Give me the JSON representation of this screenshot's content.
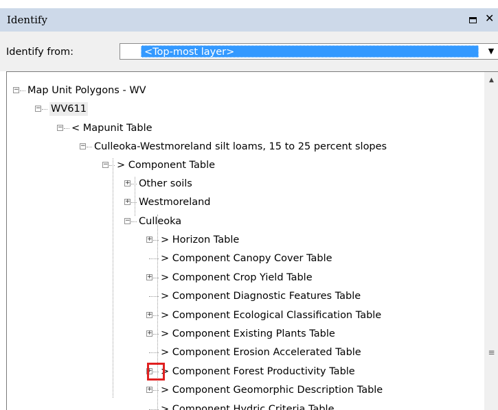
{
  "window": {
    "title": "Identify",
    "maximize_icon": "maximize-icon",
    "close_icon": "close-icon",
    "close_glyph": "✕"
  },
  "identify_from": {
    "label": "Identify from:",
    "value": "<Top-most layer>"
  },
  "tree": {
    "nodes": [
      {
        "label": "Map Unit Polygons - WV",
        "expander": "minus"
      },
      {
        "label": "WV611",
        "expander": "minus"
      },
      {
        "label": "< Mapunit Table",
        "expander": "minus"
      },
      {
        "label": "Culleoka-Westmoreland silt loams, 15 to 25 percent slopes",
        "expander": "minus"
      },
      {
        "label": "> Component Table",
        "expander": "minus"
      },
      {
        "label": "Other soils",
        "expander": "plus"
      },
      {
        "label": "Westmoreland",
        "expander": "plus"
      },
      {
        "label": "Culleoka",
        "expander": "minus"
      },
      {
        "label": "> Horizon Table",
        "expander": "plus"
      },
      {
        "label": "> Component Canopy Cover Table",
        "expander": "none"
      },
      {
        "label": "> Component Crop Yield Table",
        "expander": "plus"
      },
      {
        "label": "> Component Diagnostic Features Table",
        "expander": "none"
      },
      {
        "label": "> Component Ecological Classification Table",
        "expander": "plus"
      },
      {
        "label": "> Component Existing Plants Table",
        "expander": "plus"
      },
      {
        "label": "> Component Erosion Accelerated Table",
        "expander": "none"
      },
      {
        "label": "> Component Forest Productivity Table",
        "expander": "plus"
      },
      {
        "label": "> Component Geomorphic Description Table",
        "expander": "plus"
      },
      {
        "label": "> Component Hydric Criteria Table",
        "expander": "none"
      }
    ]
  },
  "colors": {
    "titlebar": "#cdd9e9",
    "selection": "#3399ff",
    "highlight_box": "#e02020"
  }
}
